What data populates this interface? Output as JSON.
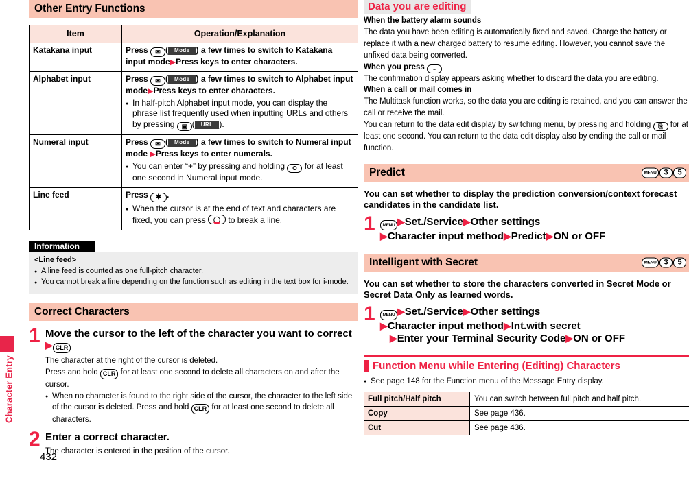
{
  "sidebar": {
    "label": "Character Entry"
  },
  "page_number": "432",
  "left": {
    "section_title": "Other Entry Functions",
    "table": {
      "headers": [
        "Item",
        "Operation/Explanation"
      ],
      "rows": [
        {
          "item": "Katakana input",
          "lead_before": "Press",
          "key_icon": "mail-key-icon",
          "badge": "Mode",
          "lead_after": "a few times to switch to Katakana input mode",
          "lead_tail": "Press keys to enter characters.",
          "notes": []
        },
        {
          "item": "Alphabet input",
          "lead_before": "Press",
          "key_icon": "mail-key-icon",
          "badge": "Mode",
          "lead_after": "a few times to switch to Alphabet input mode",
          "lead_tail": "Press keys to enter characters.",
          "notes": [
            {
              "text_before": "In half-pitch Alphabet input mode, you can display the phrase list frequently used when inputting URLs and others by pressing",
              "key_icon": "camera-key-icon",
              "badge": "URL",
              "text_after": "."
            }
          ]
        },
        {
          "item": "Numeral input",
          "lead_before": "Press",
          "key_icon": "mail-key-icon",
          "badge": "Mode",
          "lead_after": "a few times to switch to Numeral input mode",
          "lead_tail": "Press keys to enter numerals.",
          "notes": [
            {
              "text_before": "You can enter “+” by pressing and holding",
              "key_icon": "zero-key-icon",
              "key_label": "O",
              "text_after": "for at least one second in Numeral input mode."
            }
          ]
        },
        {
          "item": "Line feed",
          "lead_before": "Press",
          "key_icon": "star-key-icon",
          "key_label": "✳",
          "lead_after": ".",
          "notes": [
            {
              "text_before": "When the cursor is at the end of text and characters are fixed, you can press",
              "key_icon": "navigation-key-icon",
              "text_after": "to break a line."
            }
          ]
        }
      ]
    },
    "information": {
      "title": "Information",
      "subtitle": "<Line feed>",
      "bullets": [
        "A line feed is counted as one full-pitch character.",
        "You cannot break a line depending on the function such as editing in the text box for i-mode."
      ]
    },
    "correct_characters": {
      "section_title": "Correct Characters",
      "steps": [
        {
          "num": "1",
          "head_text": "Move the cursor to the left of the character you want to correct",
          "head_key": "CLR",
          "desc_lines": [
            "The character at the right of the cursor is deleted.",
            "Press and hold (CLR) for at least one second to delete all characters on and after the cursor."
          ],
          "desc_line1": "The character at the right of the cursor is deleted.",
          "desc_line2_a": "Press and hold",
          "desc_line2_key": "CLR",
          "desc_line2_b": "for at least one second to delete all characters on and after the cursor.",
          "bullet_a": "When no character is found to the right side of the cursor, the character to the left side of the cursor is deleted. Press and hold",
          "bullet_key": "CLR",
          "bullet_b": "for at least one second to delete all characters."
        },
        {
          "num": "2",
          "head_text": "Enter a correct character.",
          "desc_line1": "The character is entered in the position of the cursor."
        }
      ]
    }
  },
  "right": {
    "data_editing": {
      "title": "Data you are editing",
      "block1_heading": "When the battery alarm sounds",
      "block1_text": "The data you have been editing is automatically fixed and saved. Charge the battery or replace it with a new charged battery to resume editing. However, you cannot save the unfixed data being converted.",
      "block2_heading_a": "When you press",
      "block2_key": "end-call-key-icon",
      "block2_text": "The confirmation display appears asking whether to discard the data you are editing.",
      "block3_heading": "When a call or mail comes in",
      "block3_text": "The Multitask function works, so the data you are editing is retained, and you can answer the call or receive the mail.",
      "block4_text_a": "You can return to the data edit display by switching menu, by pressing and holding",
      "block4_key": "multitask-key-icon",
      "block4_text_b": "for at least one second. You can return to the data edit display also by ending the call or mail function."
    },
    "predict": {
      "title": "Predict",
      "keys": [
        "MENU",
        "3",
        "5"
      ],
      "description": "You can set whether to display the prediction conversion/context forecast candidates in the candidate list.",
      "step_num": "1",
      "step_key": "MENU",
      "step_line1_a": "Set./Service",
      "step_line1_b": "Other settings",
      "step_line2_a": "Character input method",
      "step_line2_b": "Predict",
      "step_line2_c": "ON or OFF"
    },
    "intelligent_secret": {
      "title": "Intelligent with Secret",
      "keys": [
        "MENU",
        "3",
        "5"
      ],
      "description": "You can set whether to store the characters converted in Secret Mode or Secret Data Only as learned words.",
      "step_num": "1",
      "step_key": "MENU",
      "step_line1_a": "Set./Service",
      "step_line1_b": "Other settings",
      "step_line2_a": "Character input method",
      "step_line2_b": "Int.with secret",
      "step_line3_a": "Enter your Terminal Security Code",
      "step_line3_b": "ON or OFF"
    },
    "function_menu": {
      "title": "Function Menu while Entering (Editing) Characters",
      "note": "See page 148 for the Function menu of the Message Entry display.",
      "rows": [
        {
          "key": "Full pitch/Half pitch",
          "value": "You can switch between full pitch and half pitch."
        },
        {
          "key": "Copy",
          "value": "See page 436."
        },
        {
          "key": "Cut",
          "value": "See page 436."
        }
      ]
    }
  },
  "colors": {
    "accent_red": "#ee2144",
    "header_pink": "#f9c3b2",
    "table_header_pink": "#fbe3dc",
    "gray_header": "#e8e8e8",
    "info_gray": "#ededed"
  }
}
